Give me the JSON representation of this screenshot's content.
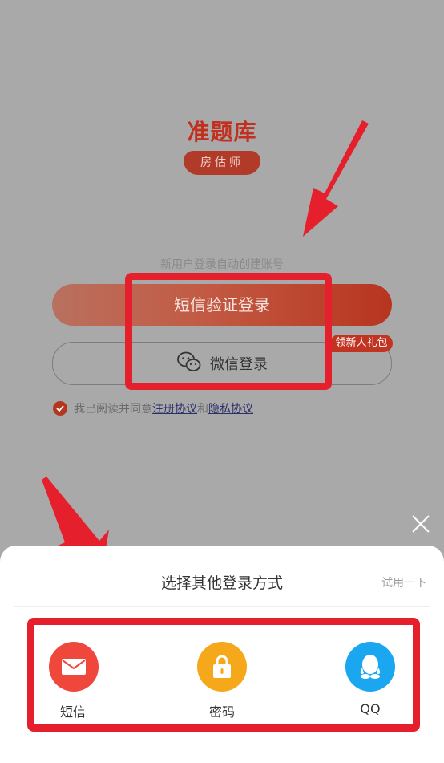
{
  "logo": {
    "title": "准题库",
    "badge": "房估师"
  },
  "login": {
    "hint": "新用户登录自动创建账号",
    "sms_button": "短信验证登录",
    "gift_badge": "领新人礼包",
    "wechat_button": "微信登录",
    "agree_text": "我已阅读并同意",
    "register_link": "注册协议",
    "and_text": "和",
    "privacy_link": "隐私协议"
  },
  "sheet": {
    "title": "选择其他登录方式",
    "try_link": "试用一下",
    "options": [
      {
        "label": "短信",
        "icon": "mail-icon",
        "color": "#f0473d"
      },
      {
        "label": "密码",
        "icon": "lock-icon",
        "color": "#f6a81b"
      },
      {
        "label": "QQ",
        "icon": "qq-icon",
        "color": "#1aa7f0"
      }
    ]
  },
  "colors": {
    "overlay": "#a9a9a9",
    "brand": "#c22f1f",
    "highlight": "#e5202c"
  }
}
